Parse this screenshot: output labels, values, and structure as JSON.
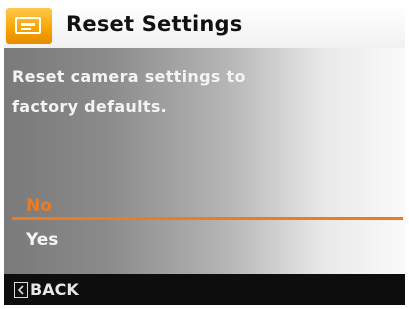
{
  "header": {
    "title": "Reset Settings",
    "icon": "settings-menu-icon"
  },
  "message": {
    "line1": "Reset camera settings to",
    "line2": "factory defaults."
  },
  "options": [
    {
      "label": "No",
      "selected": true
    },
    {
      "label": "Yes",
      "selected": false
    }
  ],
  "footer": {
    "back_label": "BACK",
    "back_icon": "chevron-left-icon"
  },
  "colors": {
    "accent": "#f07a20",
    "title_icon_bg": "#f7a300",
    "footer_bg": "#0d0d0d"
  }
}
